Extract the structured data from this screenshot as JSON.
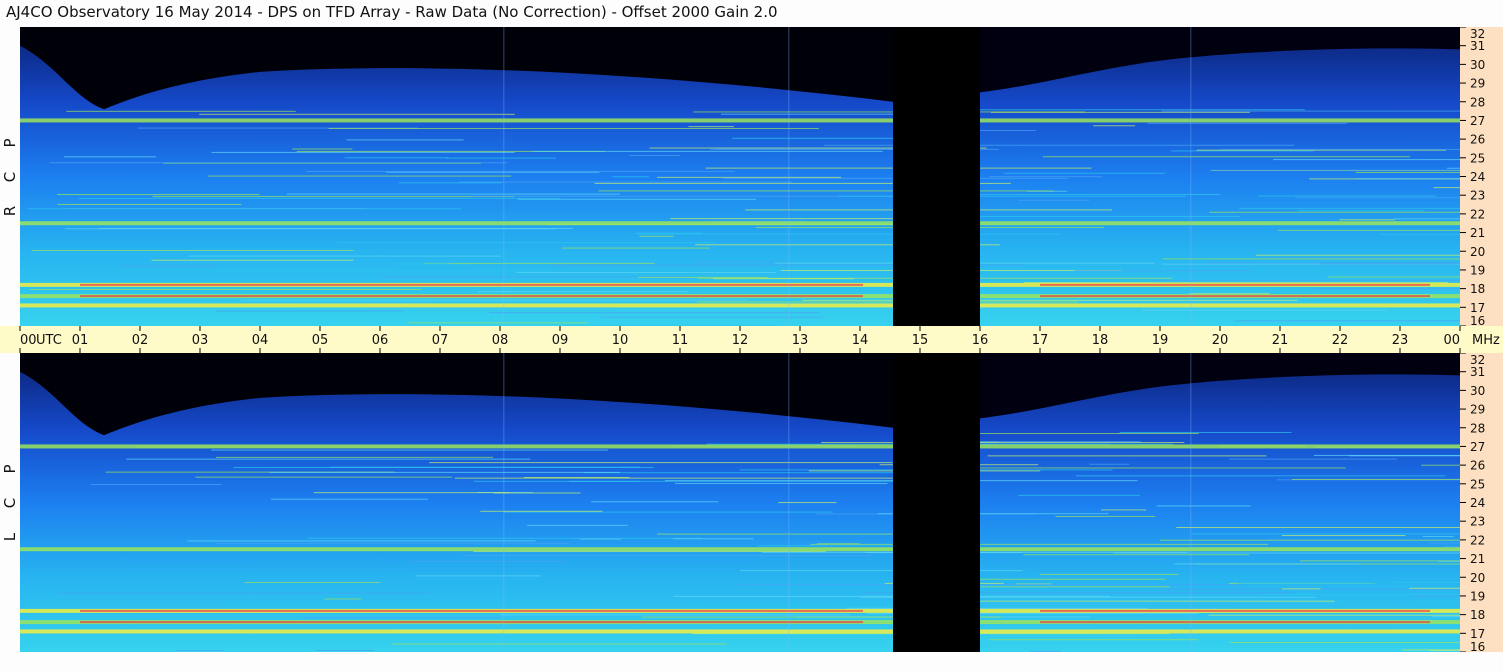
{
  "title": "AJ4CO Observatory  16 May 2014  -  DPS on TFD Array  -  Raw Data (No Correction)  -  Offset 2000  Gain 2.0",
  "colors": {
    "sky_black": "#000000",
    "deep_blue": "#0a2a8a",
    "mid_blue": "#1f6fe8",
    "cyan": "#2bc6ee",
    "green": "#9be45a",
    "yellow": "#f2ee40",
    "red": "#f03a4e",
    "freq_axis_bg": "#fde0c2",
    "time_axis_bg": "#fffbc9"
  },
  "chart_data": [
    {
      "type": "heatmap",
      "panel": "RCP",
      "side_label_letters": [
        "R",
        "C",
        "P"
      ],
      "x_axis": {
        "unit": "UTC",
        "range": [
          0,
          24
        ],
        "tick_labels": [
          "00",
          "01",
          "02",
          "03",
          "04",
          "05",
          "06",
          "07",
          "08",
          "09",
          "10",
          "11",
          "12",
          "13",
          "14",
          "15",
          "16",
          "17",
          "18",
          "19",
          "20",
          "21",
          "22",
          "23",
          "00"
        ]
      },
      "y_axis": {
        "unit": "MHz",
        "range": [
          16,
          32
        ],
        "tick_labels": [
          "32",
          "31",
          "30",
          "29",
          "28",
          "27",
          "26",
          "25",
          "24",
          "23",
          "22",
          "21",
          "20",
          "19",
          "18",
          "17",
          "16"
        ]
      },
      "data_gap_utc": [
        14.55,
        16.0
      ],
      "strong_bands_mhz": [
        17.1,
        17.6,
        18.2,
        21.5,
        27.0
      ]
    },
    {
      "type": "heatmap",
      "panel": "LCP",
      "side_label_letters": [
        "L",
        "C",
        "P"
      ],
      "x_axis": {
        "unit": "UTC",
        "range": [
          0,
          24
        ]
      },
      "y_axis": {
        "unit": "MHz",
        "range": [
          16,
          32
        ],
        "tick_labels": [
          "32",
          "31",
          "30",
          "29",
          "28",
          "27",
          "26",
          "25",
          "24",
          "23",
          "22",
          "21",
          "20",
          "19",
          "18",
          "17",
          "16"
        ]
      },
      "data_gap_utc": [
        14.55,
        16.0
      ],
      "strong_bands_mhz": [
        17.1,
        17.6,
        18.2,
        21.5,
        27.0
      ]
    }
  ],
  "time_axis": {
    "utc_label": "UTC",
    "mhz_label": "MHz"
  }
}
